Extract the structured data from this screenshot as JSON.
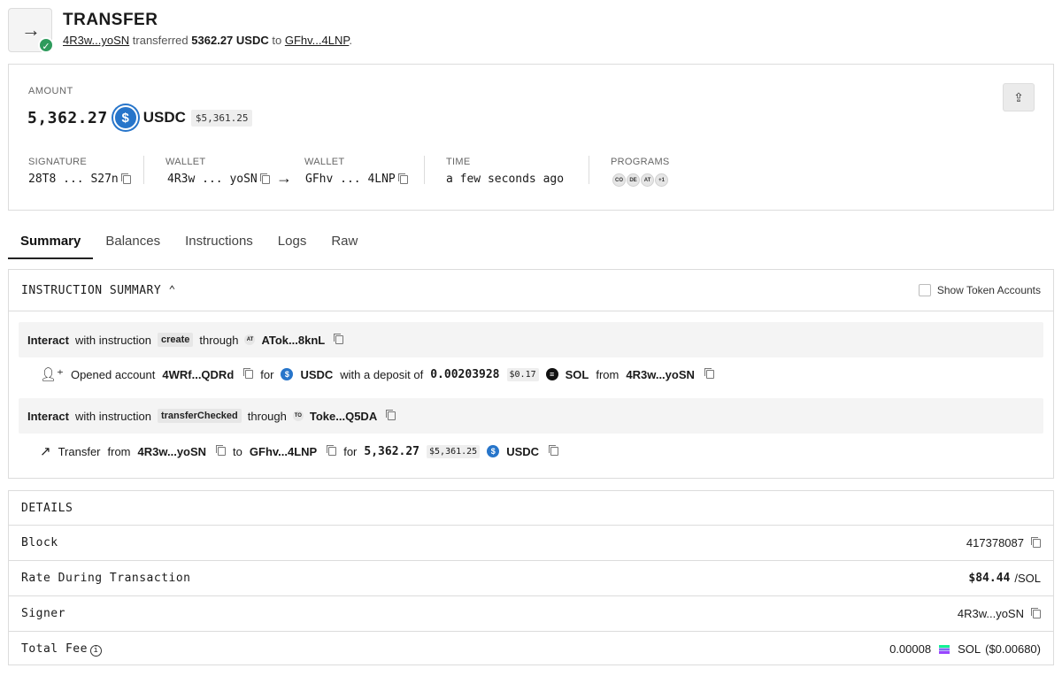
{
  "header": {
    "title": "TRANSFER",
    "from": "4R3w...yoSN",
    "verb": "transferred",
    "amount_text": "5362.27 USDC",
    "to_word": "to",
    "to": "GFhv...4LNP",
    "period": "."
  },
  "summary": {
    "amount_label": "AMOUNT",
    "amount": "5,362.27",
    "token": "USDC",
    "usd": "$5,361.25",
    "signature_label": "SIGNATURE",
    "signature": "28T8 ... S27n",
    "wallet_from_label": "WALLET",
    "wallet_from": "4R3w ... yoSN",
    "wallet_to_label": "WALLET",
    "wallet_to": "GFhv ... 4LNP",
    "time_label": "TIME",
    "time": "a few seconds ago",
    "programs_label": "PROGRAMS",
    "programs": [
      "CO",
      "DE",
      "AT",
      "+1"
    ]
  },
  "tabs": [
    "Summary",
    "Balances",
    "Instructions",
    "Logs",
    "Raw"
  ],
  "instruction_summary": {
    "title": "INSTRUCTION SUMMARY",
    "show_token_accounts": "Show Token Accounts",
    "ix1": {
      "interact": "Interact",
      "with": "with instruction",
      "name": "create",
      "through": "through",
      "prog_badge": "AT",
      "program": "ATok...8knL"
    },
    "act1": {
      "label": "Opened account",
      "account": "4WRf...QDRd",
      "for": "for",
      "token": "USDC",
      "deposit_text": "with a deposit of",
      "deposit": "0.00203928",
      "deposit_usd": "$0.17",
      "sol": "SOL",
      "from": "from",
      "from_acct": "4R3w...yoSN"
    },
    "ix2": {
      "interact": "Interact",
      "with": "with instruction",
      "name": "transferChecked",
      "through": "through",
      "prog_badge": "TO",
      "program": "Toke...Q5DA"
    },
    "act2": {
      "label": "Transfer",
      "from": "from",
      "from_acct": "4R3w...yoSN",
      "to": "to",
      "to_acct": "GFhv...4LNP",
      "for": "for",
      "amount": "5,362.27",
      "usd": "$5,361.25",
      "token": "USDC"
    }
  },
  "details": {
    "title": "DETAILS",
    "block_label": "Block",
    "block": "417378087",
    "rate_label": "Rate During Transaction",
    "rate": "$84.44",
    "rate_unit": "/SOL",
    "signer_label": "Signer",
    "signer": "4R3w...yoSN",
    "fee_label": "Total Fee",
    "fee": "0.00008",
    "fee_token": "SOL",
    "fee_usd": "($0.00680)"
  },
  "colors": {
    "usdc": "#2775ca",
    "success": "#2e9b5c",
    "border": "#dcdcdc"
  }
}
